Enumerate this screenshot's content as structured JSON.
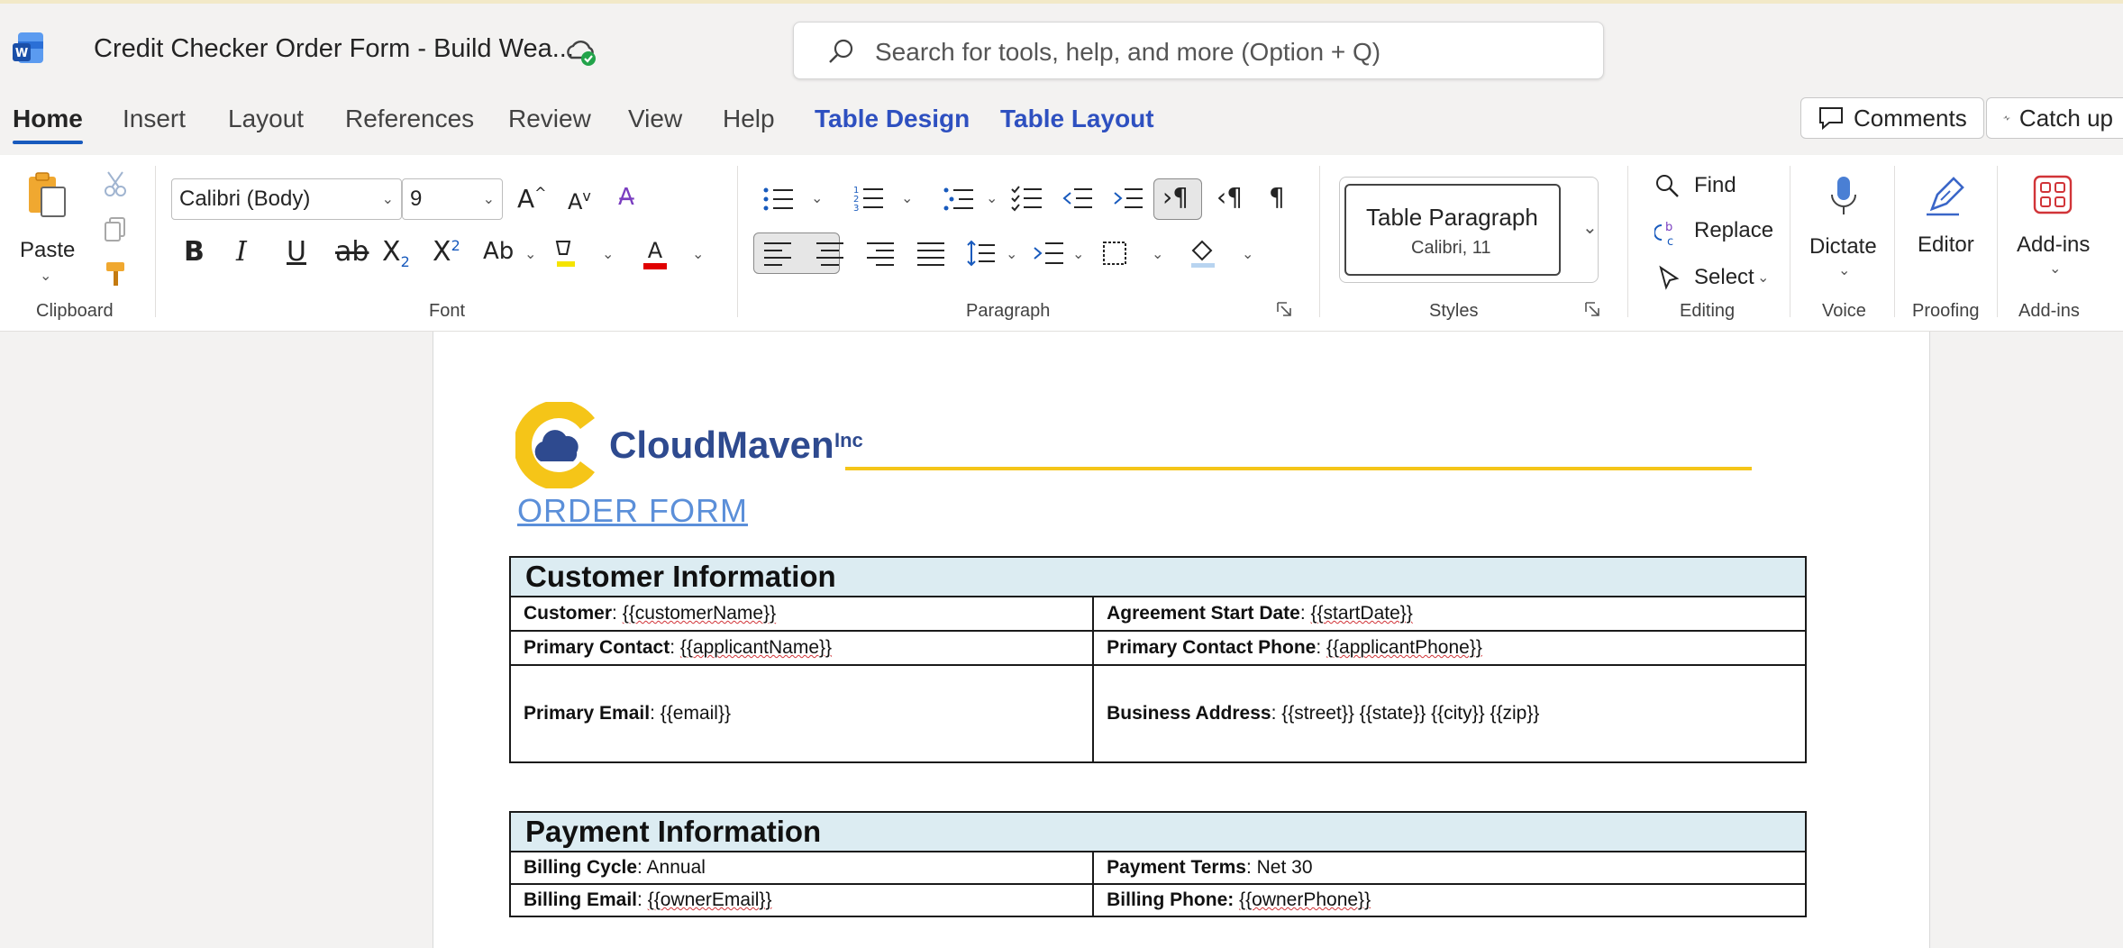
{
  "window": {
    "doc_title": "Credit Checker Order Form - Build Wea...",
    "search_placeholder": "Search for tools, help, and more (Option + Q)"
  },
  "tabs": [
    {
      "label": "Home",
      "active": true
    },
    {
      "label": "Insert"
    },
    {
      "label": "Layout"
    },
    {
      "label": "References"
    },
    {
      "label": "Review"
    },
    {
      "label": "View"
    },
    {
      "label": "Help"
    },
    {
      "label": "Table Design",
      "contextual": true
    },
    {
      "label": "Table Layout",
      "contextual": true
    }
  ],
  "header_buttons": {
    "comments": "Comments",
    "catchup": "Catch up"
  },
  "ribbon": {
    "clipboard": {
      "paste": "Paste",
      "label": "Clipboard"
    },
    "font": {
      "name": "Calibri (Body)",
      "size": "9",
      "label": "Font"
    },
    "paragraph": {
      "label": "Paragraph"
    },
    "styles": {
      "style_name": "Table Paragraph",
      "style_font": "Calibri, 11",
      "label": "Styles"
    },
    "editing": {
      "find": "Find",
      "replace": "Replace",
      "select": "Select",
      "label": "Editing"
    },
    "voice": {
      "dictate": "Dictate",
      "label": "Voice"
    },
    "proofing": {
      "editor": "Editor",
      "label": "Proofing"
    },
    "addins": {
      "addins": "Add-ins",
      "label": "Add-ins"
    }
  },
  "colors": {
    "accent": "#185abd",
    "contextual_tab": "#2e50c0",
    "logo_blue": "#2e4a8f",
    "logo_yellow": "#f5c518",
    "table_header_bg": "#dcecf2"
  },
  "document": {
    "logo_name": "CloudMaven",
    "logo_suffix": "Inc",
    "title": "ORDER FORM",
    "customer_info": {
      "heading": "Customer Information",
      "customer_label": "Customer",
      "customer_value": "{{customerName}}",
      "start_label": "Agreement Start Date",
      "start_value": "{{startDate}}",
      "contact_label": "Primary Contact",
      "contact_value": "{{applicantName}}",
      "phone_label": "Primary Contact Phone",
      "phone_value": "{{applicantPhone}}",
      "email_label": "Primary Email",
      "email_value": "{{email}}",
      "address_label": "Business Address",
      "address_value": "{{street}} {{state}} {{city}} {{zip}}"
    },
    "payment_info": {
      "heading": "Payment Information",
      "cycle_label": "Billing Cycle",
      "cycle_value": "Annual",
      "terms_label": "Payment Terms",
      "terms_value": "Net 30",
      "bemail_label": "Billing Email",
      "bemail_value": "{{ownerEmail}}",
      "bphone_label": "Billing Phone:",
      "bphone_value": "{{ownerPhone}}"
    }
  }
}
